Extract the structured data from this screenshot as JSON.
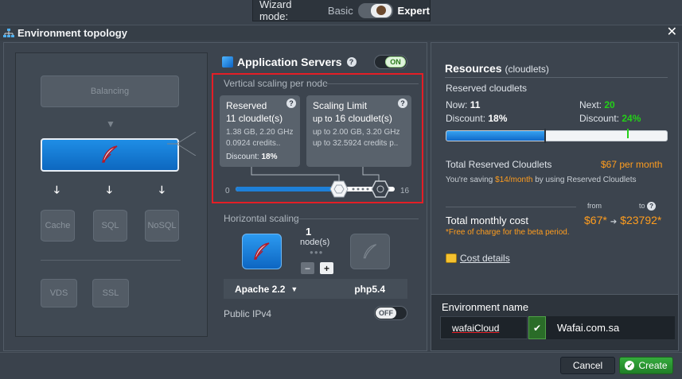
{
  "wizard": {
    "label": "Wizard mode:",
    "basic": "Basic",
    "expert": "Expert"
  },
  "window": {
    "title": "Environment topology",
    "close": "✕"
  },
  "topology": {
    "balancing": "Balancing",
    "databases": [
      "Cache",
      "SQL",
      "NoSQL"
    ],
    "extras": [
      "VDS",
      "SSL"
    ]
  },
  "app_servers": {
    "title": "Application Servers",
    "toggle": "ON",
    "vertical_label": "Vertical scaling per node",
    "reserved": {
      "title": "Reserved",
      "cloudlets": "11 cloudlet(s)",
      "specs": "1.38 GB, 2.20 GHz",
      "credits": "0.0924 credits..",
      "discount_label": "Discount:",
      "discount_value": "18%"
    },
    "limit": {
      "title": "Scaling Limit",
      "cloudlets_prefix": "up to",
      "cloudlets": "16 cloudlet(s)",
      "specs_prefix": "up to",
      "specs": "2.00 GB, 3.20 GHz",
      "credits_prefix": "up to",
      "credits": "32.5924 credits p.."
    },
    "slider": {
      "min": "0",
      "max": "16",
      "reserved": 11,
      "limit": 16
    },
    "horizontal_label": "Horizontal scaling",
    "node_count": "1",
    "nodes_label": "node(s)",
    "minus": "−",
    "plus": "+",
    "stack": "Apache 2.2",
    "php": "php5.4",
    "ipv4_label": "Public IPv4",
    "ipv4_toggle": "OFF"
  },
  "resources": {
    "title": "Resources",
    "title_unit": "(cloudlets)",
    "reserved_label": "Reserved cloudlets",
    "now_label": "Now:",
    "now_value": "11",
    "next_label": "Next:",
    "next_value": "20",
    "discount_label": "Discount:",
    "now_discount": "18%",
    "next_discount": "24%",
    "bar_fill_percent": 44.6,
    "total_reserved_label": "Total Reserved Cloudlets",
    "total_reserved_value": "$67 per month",
    "saving_prefix": "You're saving",
    "saving_value": "$14/month",
    "saving_suffix": "by using Reserved Cloudlets",
    "from_label": "from",
    "to_label": "to",
    "tmc_label": "Total monthly cost",
    "tmc_from": "$67*",
    "tmc_to": "$23792*",
    "beta_note": "*Free of charge for the beta period.",
    "cost_details": "Cost details"
  },
  "env": {
    "label": "Environment name",
    "name": "wafaiCloud",
    "domain": "Wafai.com.sa"
  },
  "footer": {
    "cancel": "Cancel",
    "create": "Create"
  },
  "colors": {
    "accent_blue": "#1b7fd8",
    "green": "#24d018",
    "orange": "#ff9d1e",
    "highlight_red": "#e41e26"
  }
}
